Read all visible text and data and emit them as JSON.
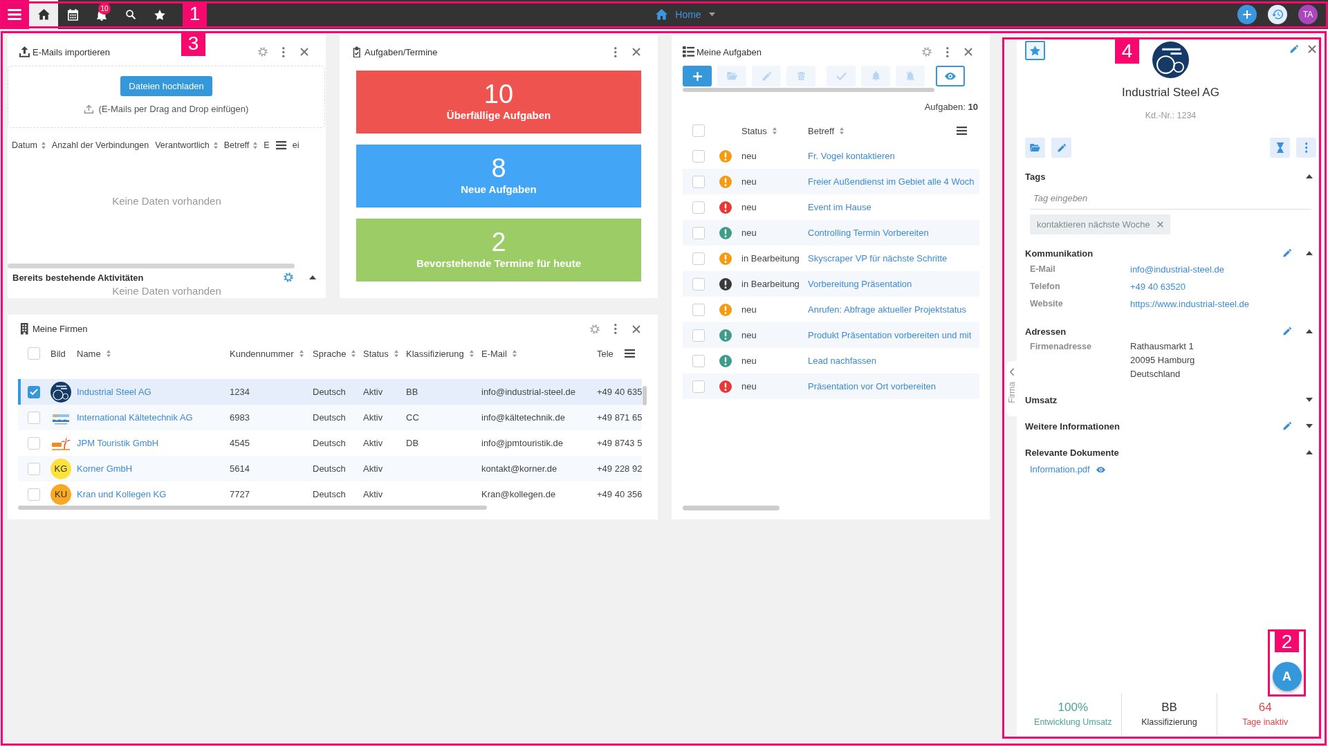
{
  "top_bar": {
    "annotation": "1",
    "buttons": [
      {
        "kind": "menu",
        "selected": false
      },
      {
        "kind": "home",
        "selected": true
      },
      {
        "kind": "calendar",
        "selected": false
      },
      {
        "kind": "notifications",
        "selected": false,
        "badge": "10"
      },
      {
        "kind": "search",
        "selected": false
      },
      {
        "kind": "favorites",
        "selected": false
      }
    ],
    "page_menu": {
      "label": "Home"
    },
    "actions": [
      {
        "kind": "add"
      },
      {
        "kind": "history"
      },
      {
        "kind": "avatar",
        "initials": "TA"
      }
    ]
  },
  "dashboard_annotation": "3",
  "email_import": {
    "title": "E-Mails importieren",
    "upload_button": "Dateien hochladen",
    "drop_hint": "(E-Mails per Drag and Drop einfügen)",
    "columns": [
      {
        "label": "Datum",
        "sortable": true
      },
      {
        "label": "Anzahl der Verbindungen",
        "sortable": false
      },
      {
        "label": "Verantwortlich",
        "sortable": true
      },
      {
        "label": "Betreff",
        "sortable": true
      },
      {
        "label": "E",
        "sortable": false
      }
    ],
    "column_6": "ei",
    "empty_text": "Keine Daten vorhanden",
    "activities": {
      "title": "Bereits bestehende Aktivitäten",
      "expanded": true,
      "empty_text": "Keine Daten vorhanden"
    }
  },
  "task_summary": {
    "title": "Aufgaben/Termine",
    "tiles": [
      {
        "count": "10",
        "label": "Überfällige Aufgaben",
        "color": "#ef5350"
      },
      {
        "count": "8",
        "label": "Neue Aufgaben",
        "color": "#42a5f5"
      },
      {
        "count": "2",
        "label": "Bevorstehende Termine für heute",
        "color": "#9ccc65"
      }
    ]
  },
  "my_tasks": {
    "title": "Meine Aufgaben",
    "toolbar": [
      {
        "kind": "add",
        "disabled": false,
        "selected": false
      },
      {
        "kind": "open",
        "disabled": true,
        "selected": false
      },
      {
        "kind": "edit",
        "disabled": true,
        "selected": false
      },
      {
        "kind": "delete",
        "disabled": true,
        "selected": false
      },
      {
        "kind": "complete",
        "disabled": true,
        "selected": false
      },
      {
        "kind": "remind",
        "disabled": true,
        "selected": false
      },
      {
        "kind": "mute",
        "disabled": true,
        "selected": false
      },
      {
        "kind": "preview",
        "disabled": false,
        "selected": true
      }
    ],
    "count": "Aufgaben: **10**",
    "all_checked": false,
    "columns": [
      {
        "label": "Status",
        "sortable": true
      },
      {
        "label": "Betreff",
        "sortable": true
      }
    ],
    "rows": [
      {
        "checked": false,
        "color": "#f39c12",
        "status": "neu",
        "subject": "Fr. Vogel kontaktieren"
      },
      {
        "checked": false,
        "color": "#f39c12",
        "status": "neu",
        "subject": "Freier Außendienst im Gebiet alle 4 Woch"
      },
      {
        "checked": false,
        "color": "#e53935",
        "status": "neu",
        "subject": "Event im Hause"
      },
      {
        "checked": false,
        "color": "#3f9c8c",
        "status": "neu",
        "subject": "Controlling Termin Vorbereiten"
      },
      {
        "checked": false,
        "color": "#f39c12",
        "status": "in Bearbeitung",
        "subject": "Skyscraper VP für nächste Schritte"
      },
      {
        "checked": false,
        "color": "#3a3a3a",
        "status": "in Bearbeitung",
        "subject": "Vorbereitung Präsentation"
      },
      {
        "checked": false,
        "color": "#f39c12",
        "status": "neu",
        "subject": "Anrufen: Abfrage aktueller Projektstatus"
      },
      {
        "checked": false,
        "color": "#3f9c8c",
        "status": "neu",
        "subject": "Produkt Präsentation vorbereiten und mit"
      },
      {
        "checked": false,
        "color": "#3f9c8c",
        "status": "neu",
        "subject": "Lead nachfassen"
      },
      {
        "checked": false,
        "color": "#e53935",
        "status": "neu",
        "subject": "Präsentation vor Ort vorbereiten"
      }
    ]
  },
  "companies": {
    "title": "Meine Firmen",
    "all_checked": false,
    "columns": [
      {
        "label": "Bild",
        "sortable": false
      },
      {
        "label": "Name",
        "sortable": true
      },
      {
        "label": "Kundennummer",
        "sortable": true
      },
      {
        "label": "Sprache",
        "sortable": true
      },
      {
        "label": "Status",
        "sortable": true
      },
      {
        "label": "Klassifizierung",
        "sortable": true
      },
      {
        "label": "E-Mail",
        "sortable": true
      },
      {
        "label": "Tele",
        "sortable": false
      }
    ],
    "rows": [
      {
        "selected": true,
        "checked": true,
        "image": {
          "kind": "bubbles"
        },
        "name": "Industrial Steel AG",
        "customer_number": "1234",
        "language": "Deutsch",
        "status": "Aktiv",
        "classification": "BB",
        "email": "info@industrial-steel.de",
        "phone": "+49 40 635"
      },
      {
        "selected": false,
        "checked": false,
        "image": {
          "kind": "banner"
        },
        "name": "International Kältetechnik AG",
        "customer_number": "6983",
        "language": "Deutsch",
        "status": "Aktiv",
        "classification": "CC",
        "email": "info@kältetechnik.de",
        "phone": "+49 871 65"
      },
      {
        "selected": false,
        "checked": false,
        "image": {
          "kind": "palm"
        },
        "name": "JPM Touristik GmbH",
        "customer_number": "4545",
        "language": "Deutsch",
        "status": "Aktiv",
        "classification": "DB",
        "email": "info@jpmtouristik.de",
        "phone": "+49 8743 5"
      },
      {
        "selected": false,
        "checked": false,
        "image": {
          "kind": "initials",
          "initials": "KG",
          "color": "#fde23b"
        },
        "name": "Korner GmbH",
        "customer_number": "5614",
        "language": "Deutsch",
        "status": "Aktiv",
        "email": "kontakt@korner.de",
        "phone": "+49 228 92"
      },
      {
        "selected": false,
        "checked": false,
        "image": {
          "kind": "initials",
          "initials": "KU",
          "color": "#f9a825"
        },
        "name": "Kran und Kollegen KG",
        "customer_number": "7727",
        "language": "Deutsch",
        "status": "Aktiv",
        "email": "Kran@kollegen.de",
        "phone": "+49 40 356"
      }
    ]
  },
  "company_detail": {
    "annotation": "4",
    "favorite": true,
    "logo": {
      "kind": "bubbles"
    },
    "name": "Industrial Steel AG",
    "customer_number": "Kd.-Nr.: 1234",
    "actions": [
      {
        "kind": "folder"
      },
      {
        "kind": "edit"
      },
      {
        "kind": "reminder"
      },
      {
        "kind": "more"
      }
    ],
    "sections": [
      {
        "kind": "tags",
        "title": "Tags",
        "expanded": true,
        "editable": false,
        "placeholder": "Tag eingeben",
        "tags": [
          {
            "label": "kontaktieren nächste Woche"
          }
        ]
      },
      {
        "kind": "fields",
        "title": "Kommunikation",
        "expanded": true,
        "editable": true,
        "fields": [
          {
            "label": "E-Mail",
            "value": "info@industrial-steel.de",
            "link": true
          },
          {
            "label": "Telefon",
            "value": "+49 40 63520",
            "link": true
          },
          {
            "label": "Website",
            "value": "https://www.industrial-steel.de",
            "link": true
          }
        ]
      },
      {
        "kind": "fields",
        "title": "Adressen",
        "expanded": true,
        "editable": true,
        "fields": [
          {
            "label": "Firmenadresse",
            "lines": [
              "Rathausmarkt 1",
              "20095 Hamburg",
              "Deutschland"
            ],
            "link": false
          }
        ]
      },
      {
        "kind": "fields",
        "title": "Umsatz",
        "expanded": false,
        "editable": false
      },
      {
        "kind": "fields",
        "title": "Weitere Informationen",
        "expanded": false,
        "editable": true
      },
      {
        "kind": "documents",
        "title": "Relevante Dokumente",
        "expanded": true,
        "editable": false,
        "documents": [
          {
            "name": "Information.pdf"
          }
        ]
      }
    ],
    "side_tab": {
      "label": "Firma"
    },
    "stats": [
      {
        "value": "100%",
        "label": "Entwicklung Umsatz",
        "color": "#4ba396"
      },
      {
        "value": "BB",
        "label": "Klassifizierung",
        "color": "#333333"
      },
      {
        "value": "64",
        "label": "Tage inaktiv",
        "color": "#e04545"
      }
    ]
  },
  "assistant_button": {
    "annotation": "2",
    "label": "A"
  }
}
